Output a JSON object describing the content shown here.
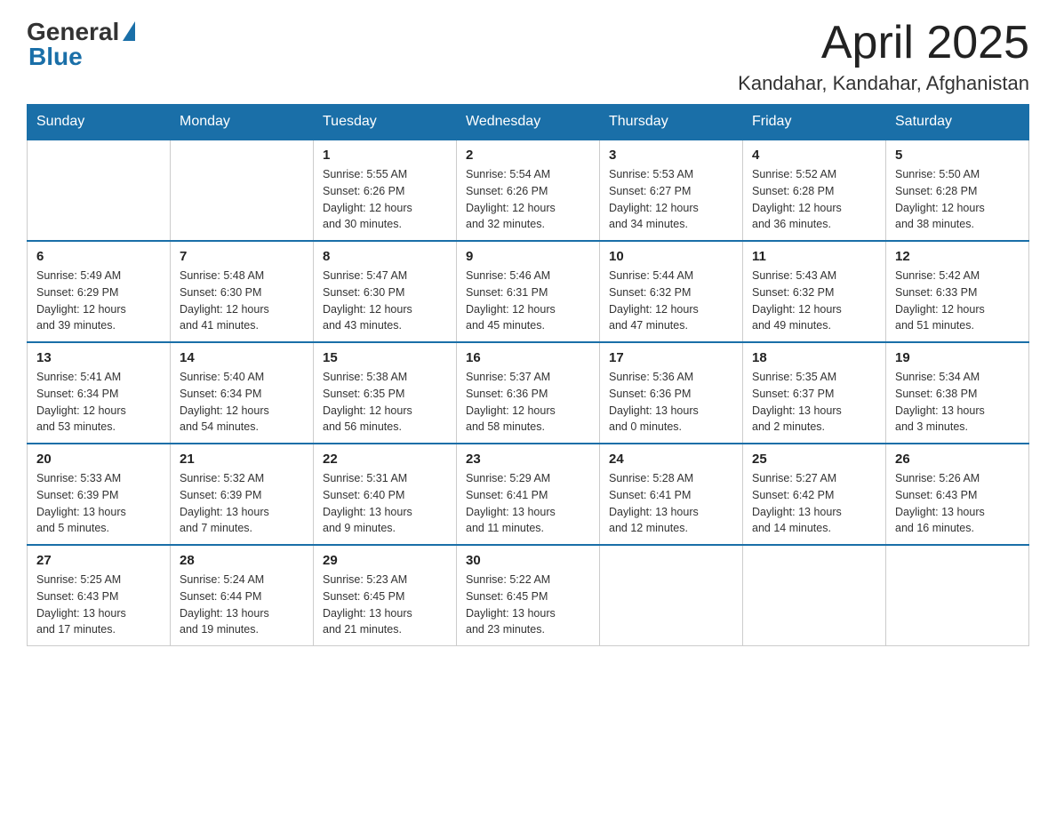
{
  "logo": {
    "general": "General",
    "blue": "Blue"
  },
  "header": {
    "month": "April 2025",
    "location": "Kandahar, Kandahar, Afghanistan"
  },
  "weekdays": [
    "Sunday",
    "Monday",
    "Tuesday",
    "Wednesday",
    "Thursday",
    "Friday",
    "Saturday"
  ],
  "weeks": [
    [
      {
        "day": "",
        "info": ""
      },
      {
        "day": "",
        "info": ""
      },
      {
        "day": "1",
        "info": "Sunrise: 5:55 AM\nSunset: 6:26 PM\nDaylight: 12 hours\nand 30 minutes."
      },
      {
        "day": "2",
        "info": "Sunrise: 5:54 AM\nSunset: 6:26 PM\nDaylight: 12 hours\nand 32 minutes."
      },
      {
        "day": "3",
        "info": "Sunrise: 5:53 AM\nSunset: 6:27 PM\nDaylight: 12 hours\nand 34 minutes."
      },
      {
        "day": "4",
        "info": "Sunrise: 5:52 AM\nSunset: 6:28 PM\nDaylight: 12 hours\nand 36 minutes."
      },
      {
        "day": "5",
        "info": "Sunrise: 5:50 AM\nSunset: 6:28 PM\nDaylight: 12 hours\nand 38 minutes."
      }
    ],
    [
      {
        "day": "6",
        "info": "Sunrise: 5:49 AM\nSunset: 6:29 PM\nDaylight: 12 hours\nand 39 minutes."
      },
      {
        "day": "7",
        "info": "Sunrise: 5:48 AM\nSunset: 6:30 PM\nDaylight: 12 hours\nand 41 minutes."
      },
      {
        "day": "8",
        "info": "Sunrise: 5:47 AM\nSunset: 6:30 PM\nDaylight: 12 hours\nand 43 minutes."
      },
      {
        "day": "9",
        "info": "Sunrise: 5:46 AM\nSunset: 6:31 PM\nDaylight: 12 hours\nand 45 minutes."
      },
      {
        "day": "10",
        "info": "Sunrise: 5:44 AM\nSunset: 6:32 PM\nDaylight: 12 hours\nand 47 minutes."
      },
      {
        "day": "11",
        "info": "Sunrise: 5:43 AM\nSunset: 6:32 PM\nDaylight: 12 hours\nand 49 minutes."
      },
      {
        "day": "12",
        "info": "Sunrise: 5:42 AM\nSunset: 6:33 PM\nDaylight: 12 hours\nand 51 minutes."
      }
    ],
    [
      {
        "day": "13",
        "info": "Sunrise: 5:41 AM\nSunset: 6:34 PM\nDaylight: 12 hours\nand 53 minutes."
      },
      {
        "day": "14",
        "info": "Sunrise: 5:40 AM\nSunset: 6:34 PM\nDaylight: 12 hours\nand 54 minutes."
      },
      {
        "day": "15",
        "info": "Sunrise: 5:38 AM\nSunset: 6:35 PM\nDaylight: 12 hours\nand 56 minutes."
      },
      {
        "day": "16",
        "info": "Sunrise: 5:37 AM\nSunset: 6:36 PM\nDaylight: 12 hours\nand 58 minutes."
      },
      {
        "day": "17",
        "info": "Sunrise: 5:36 AM\nSunset: 6:36 PM\nDaylight: 13 hours\nand 0 minutes."
      },
      {
        "day": "18",
        "info": "Sunrise: 5:35 AM\nSunset: 6:37 PM\nDaylight: 13 hours\nand 2 minutes."
      },
      {
        "day": "19",
        "info": "Sunrise: 5:34 AM\nSunset: 6:38 PM\nDaylight: 13 hours\nand 3 minutes."
      }
    ],
    [
      {
        "day": "20",
        "info": "Sunrise: 5:33 AM\nSunset: 6:39 PM\nDaylight: 13 hours\nand 5 minutes."
      },
      {
        "day": "21",
        "info": "Sunrise: 5:32 AM\nSunset: 6:39 PM\nDaylight: 13 hours\nand 7 minutes."
      },
      {
        "day": "22",
        "info": "Sunrise: 5:31 AM\nSunset: 6:40 PM\nDaylight: 13 hours\nand 9 minutes."
      },
      {
        "day": "23",
        "info": "Sunrise: 5:29 AM\nSunset: 6:41 PM\nDaylight: 13 hours\nand 11 minutes."
      },
      {
        "day": "24",
        "info": "Sunrise: 5:28 AM\nSunset: 6:41 PM\nDaylight: 13 hours\nand 12 minutes."
      },
      {
        "day": "25",
        "info": "Sunrise: 5:27 AM\nSunset: 6:42 PM\nDaylight: 13 hours\nand 14 minutes."
      },
      {
        "day": "26",
        "info": "Sunrise: 5:26 AM\nSunset: 6:43 PM\nDaylight: 13 hours\nand 16 minutes."
      }
    ],
    [
      {
        "day": "27",
        "info": "Sunrise: 5:25 AM\nSunset: 6:43 PM\nDaylight: 13 hours\nand 17 minutes."
      },
      {
        "day": "28",
        "info": "Sunrise: 5:24 AM\nSunset: 6:44 PM\nDaylight: 13 hours\nand 19 minutes."
      },
      {
        "day": "29",
        "info": "Sunrise: 5:23 AM\nSunset: 6:45 PM\nDaylight: 13 hours\nand 21 minutes."
      },
      {
        "day": "30",
        "info": "Sunrise: 5:22 AM\nSunset: 6:45 PM\nDaylight: 13 hours\nand 23 minutes."
      },
      {
        "day": "",
        "info": ""
      },
      {
        "day": "",
        "info": ""
      },
      {
        "day": "",
        "info": ""
      }
    ]
  ]
}
